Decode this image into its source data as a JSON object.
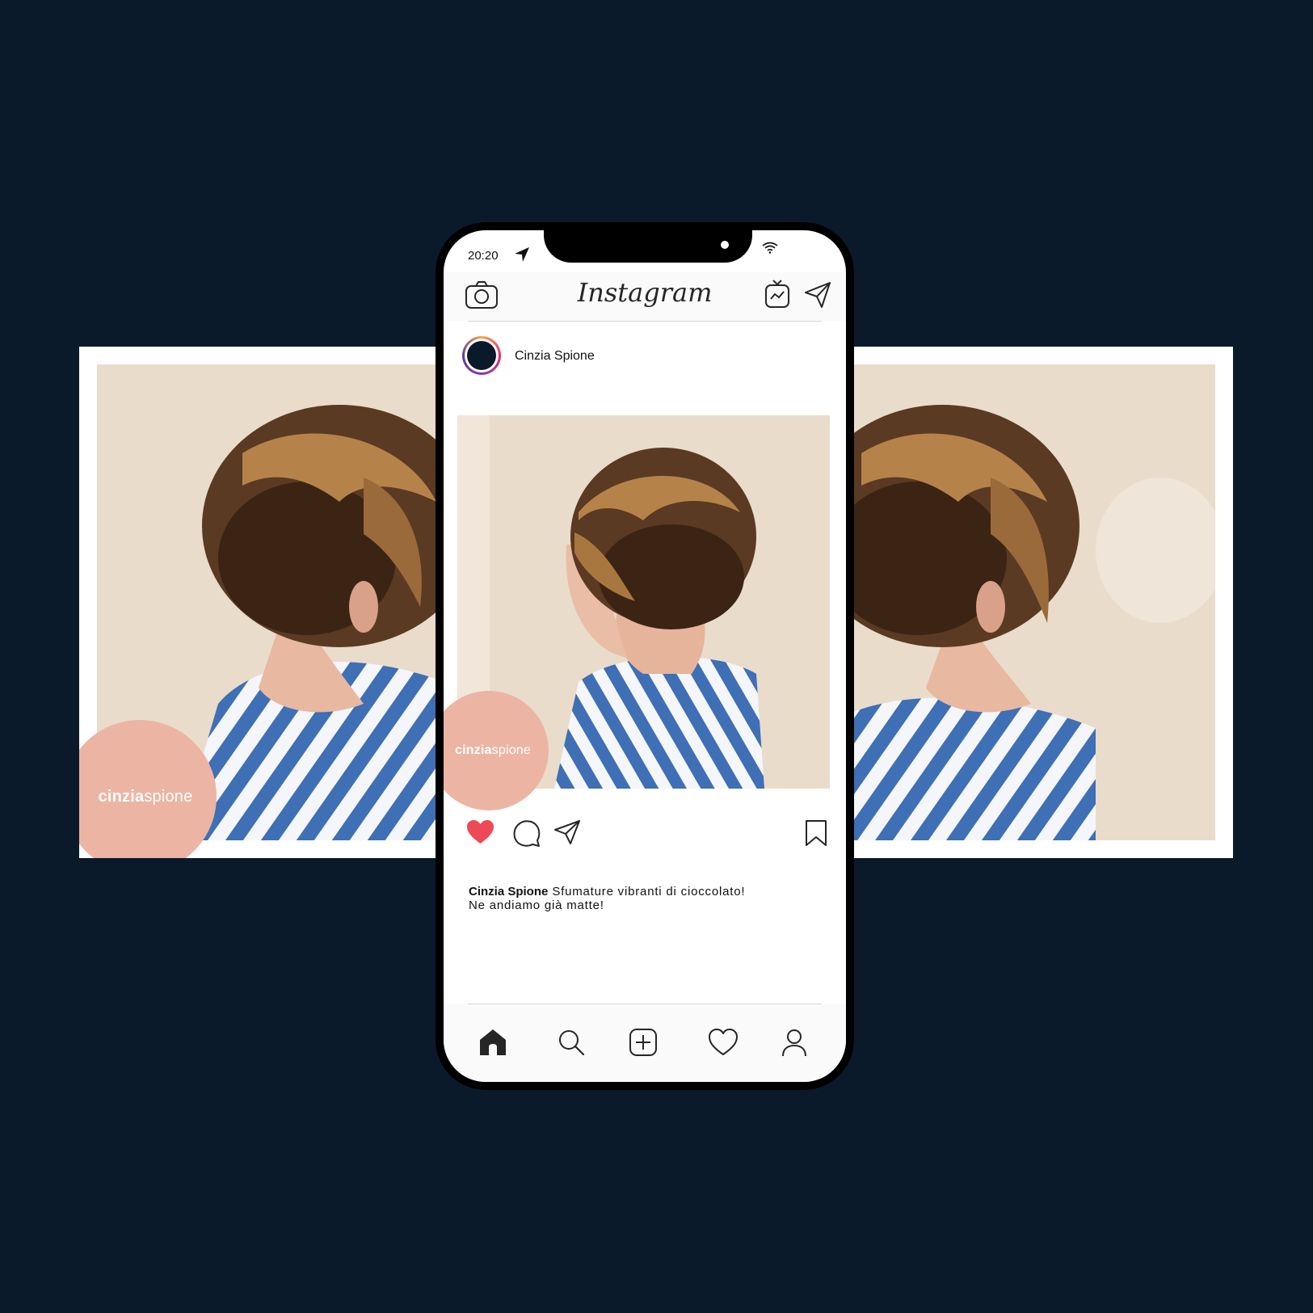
{
  "side_cards": {
    "left_brand": {
      "bold": "cinzia",
      "light": "spione"
    }
  },
  "status_bar": {
    "time": "20:20"
  },
  "app": {
    "logo": "Instagram"
  },
  "post": {
    "username": "Cinzia Spione",
    "brand": {
      "bold": "cinzia",
      "light": "spione"
    },
    "caption": {
      "author": "Cinzia Spione",
      "line1": "Sfumature vibranti di cioccolato!",
      "line2": "Ne andiamo già matte!"
    },
    "liked": true
  },
  "icons": {
    "top": [
      "camera-icon",
      "igtv-icon",
      "direct-message-icon"
    ],
    "actions": [
      "heart-icon",
      "comment-icon",
      "share-icon",
      "bookmark-icon"
    ],
    "nav": [
      "home-icon",
      "search-icon",
      "add-post-icon",
      "activity-heart-icon",
      "profile-icon"
    ]
  },
  "colors": {
    "background": "#0b1a2b",
    "brand_pink": "#ecb5a3",
    "like_red": "#ed4956",
    "shirt_blue": "#3f6fb5"
  }
}
